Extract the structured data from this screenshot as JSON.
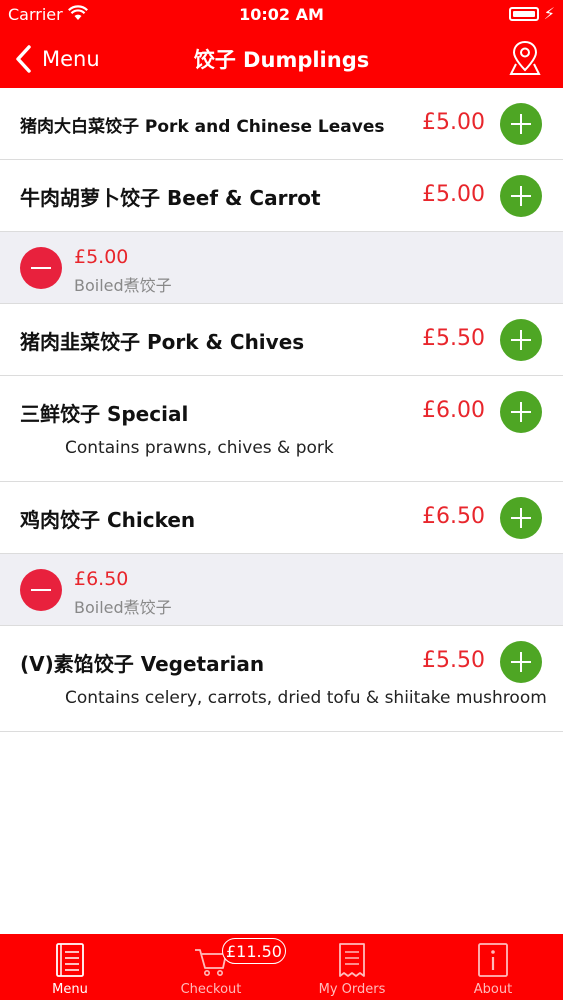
{
  "status_bar": {
    "carrier": "Carrier",
    "time": "10:02 AM"
  },
  "nav": {
    "back_label": "Menu",
    "title": "饺子 Dumplings"
  },
  "rows": [
    {
      "kind": "item",
      "name": "猪肉大白菜饺子 Pork and Chinese Leaves",
      "price": "£5.00",
      "desc": ""
    },
    {
      "kind": "item",
      "name": "牛肉胡萝卜饺子 Beef & Carrot",
      "price": "£5.00",
      "desc": ""
    },
    {
      "kind": "selected",
      "price": "£5.00",
      "label": "Boiled煮饺子"
    },
    {
      "kind": "item",
      "name": "猪肉韭菜饺子 Pork & Chives",
      "price": "£5.50",
      "desc": ""
    },
    {
      "kind": "item",
      "name": "三鲜饺子 Special",
      "price": "£6.00",
      "desc": "Contains prawns, chives & pork"
    },
    {
      "kind": "item",
      "name": "鸡肉饺子 Chicken",
      "price": "£6.50",
      "desc": ""
    },
    {
      "kind": "selected",
      "price": "£6.50",
      "label": "Boiled煮饺子"
    },
    {
      "kind": "item",
      "name": "(V)素馅饺子 Vegetarian",
      "price": "£5.50",
      "desc": "Contains celery, carrots, dried tofu & shiitake mushroom"
    }
  ],
  "tabs": [
    {
      "label": "Menu",
      "icon": "menu-book-icon",
      "active": true
    },
    {
      "label": "Checkout",
      "icon": "cart-icon",
      "active": false
    },
    {
      "label": "My Orders",
      "icon": "receipt-icon",
      "active": false
    },
    {
      "label": "About",
      "icon": "info-icon",
      "active": false
    }
  ],
  "cart_badge": "£11.50",
  "colors": {
    "bar_red": "#fe0000",
    "price_red": "#e8262c",
    "add_green": "#4ea624",
    "remove_red": "#e8213d",
    "selected_bg": "#efeff4"
  }
}
